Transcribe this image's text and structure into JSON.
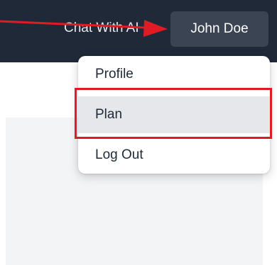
{
  "navbar": {
    "link_label": "Chat With AI",
    "user_button_label": "John Doe"
  },
  "dropdown": {
    "items": [
      {
        "label": "Profile"
      },
      {
        "label": "Plan"
      },
      {
        "label": "Log Out"
      }
    ]
  },
  "colors": {
    "navbar_bg": "#1f2937",
    "user_button_bg": "#3b4452",
    "annotation_red": "#e01b24",
    "selected_item_bg": "#e5e7eb",
    "content_bg": "#f3f4f6"
  }
}
